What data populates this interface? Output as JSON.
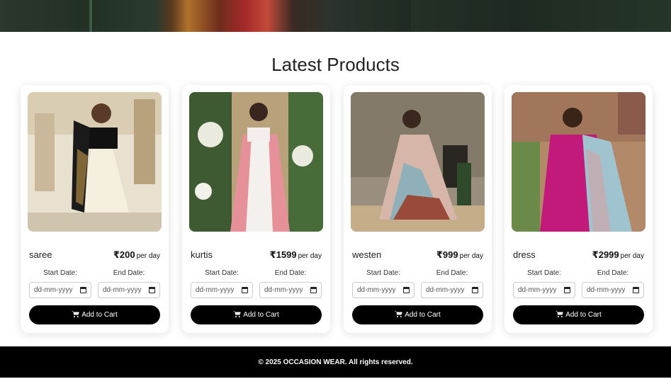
{
  "section_title": "Latest Products",
  "products": [
    {
      "name": "saree",
      "price": "₹200",
      "per": "per day",
      "start_label": "Start Date:",
      "end_label": "End Date:",
      "date_placeholder": "dd-mm-yyyy",
      "button": "Add to Cart"
    },
    {
      "name": "kurtis",
      "price": "₹1599",
      "per": "per day",
      "start_label": "Start Date:",
      "end_label": "End Date:",
      "date_placeholder": "dd-mm-yyyy",
      "button": "Add to Cart"
    },
    {
      "name": "westen",
      "price": "₹999",
      "per": "per day",
      "start_label": "Start Date:",
      "end_label": "End Date:",
      "date_placeholder": "dd-mm-yyyy",
      "button": "Add to Cart"
    },
    {
      "name": "dress",
      "price": "₹2999",
      "per": "per day",
      "start_label": "Start Date:",
      "end_label": "End Date:",
      "date_placeholder": "dd-mm-yyyy",
      "button": "Add to Cart"
    }
  ],
  "footer": "© 2025 OCCASION WEAR. All rights reserved.",
  "colors": {
    "button": "#000000",
    "footer": "#000000",
    "card_bg": "#ffffff"
  }
}
